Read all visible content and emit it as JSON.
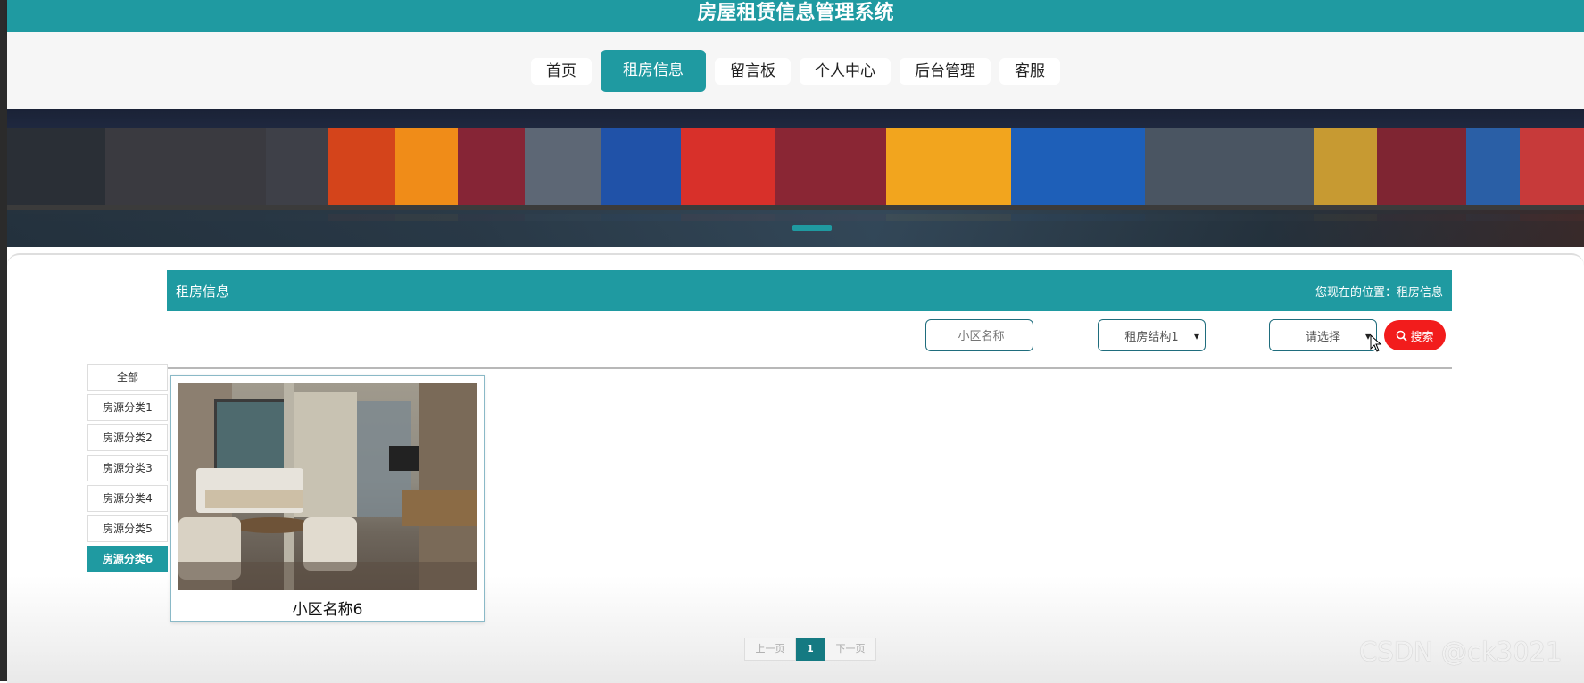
{
  "header": {
    "title": "房屋租赁信息管理系统",
    "bar_color": "#1f9aa1"
  },
  "nav": {
    "items": [
      {
        "label": "首页",
        "active": false
      },
      {
        "label": "租房信息",
        "active": true
      },
      {
        "label": "留言板",
        "active": false
      },
      {
        "label": "个人中心",
        "active": false
      },
      {
        "label": "后台管理",
        "active": false
      },
      {
        "label": "客服",
        "active": false
      }
    ]
  },
  "section": {
    "title": "租房信息",
    "location": "您现在的位置：租房信息"
  },
  "filters": {
    "community_placeholder": "小区名称",
    "structure_selected": "租房结构1",
    "option_selected": "请选择",
    "search_label": "搜索",
    "search_color": "#f21c1c"
  },
  "categories": [
    "全部",
    "房源分类1",
    "房源分类2",
    "房源分类3",
    "房源分类4",
    "房源分类5",
    "房源分类6"
  ],
  "active_category": "房源分类6",
  "listing": {
    "caption": "小区名称6"
  },
  "pagination": {
    "prev": "上一页",
    "current": "1",
    "next": "下一页"
  },
  "watermark": "CSDN @ck3021"
}
